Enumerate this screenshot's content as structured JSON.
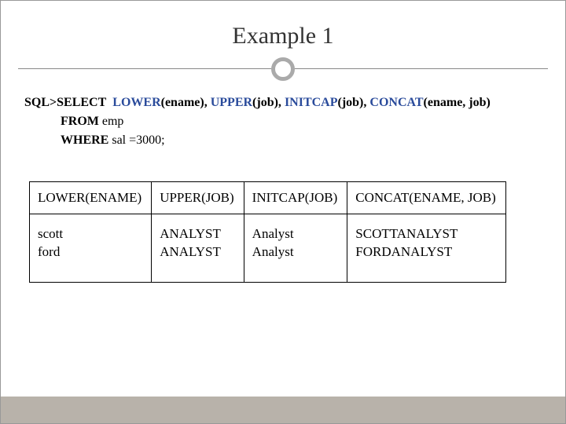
{
  "title": "Example 1",
  "sql": {
    "prefix": "SQL>",
    "kw_select": "SELECT",
    "fn_lower": "LOWER",
    "arg_lower": "(ename), ",
    "fn_upper": "UPPER",
    "arg_upper": "(job), ",
    "fn_initcap": "INITCAP",
    "arg_initcap": "(job), ",
    "fn_concat": "CONCAT",
    "arg_concat": "(ename, job)",
    "kw_from": "FROM",
    "from_rest": "  emp",
    "kw_where": "WHERE",
    "where_rest": "  sal =3000;"
  },
  "table": {
    "headers": [
      "LOWER(ENAME)",
      "UPPER(JOB)",
      "INITCAP(JOB)",
      "CONCAT(ENAME, JOB)"
    ],
    "row": {
      "c0a": "scott",
      "c0b": "ford",
      "c1a": "ANALYST",
      "c1b": "ANALYST",
      "c2a": "Analyst",
      "c2b": "Analyst",
      "c3a": "SCOTTANALYST",
      "c3b": "FORDANALYST"
    }
  }
}
